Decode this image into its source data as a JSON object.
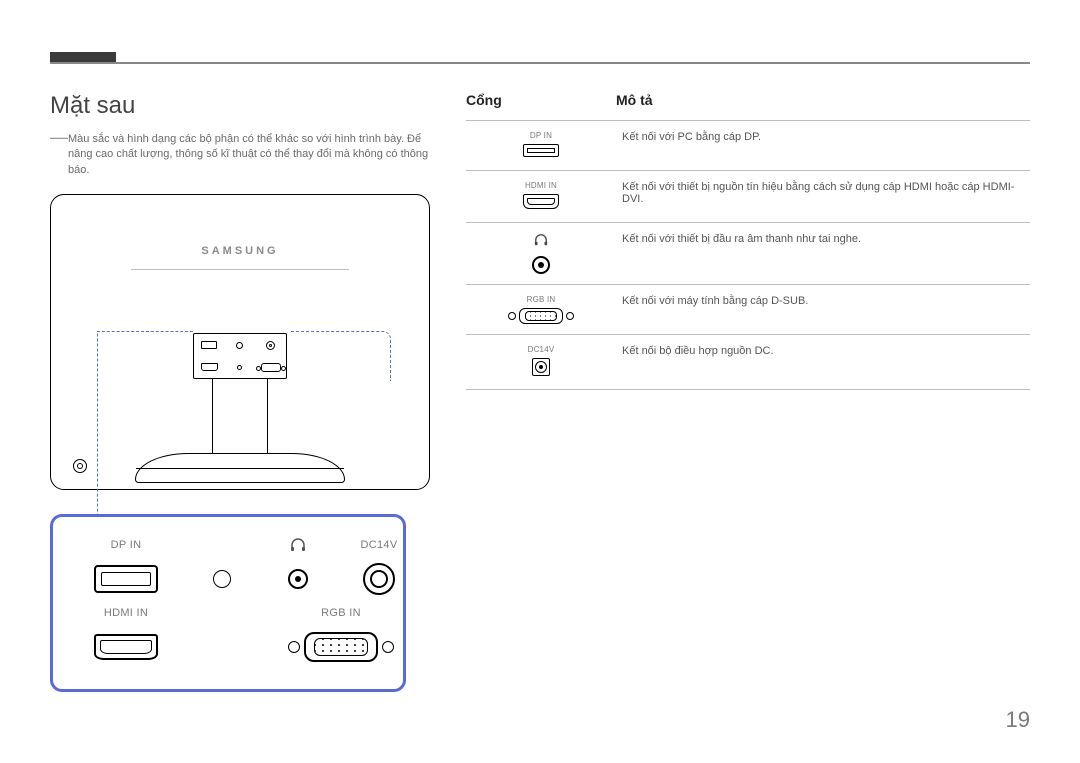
{
  "page": {
    "number": "19"
  },
  "left": {
    "heading": "Mặt sau",
    "note": "Màu sắc và hình dạng các bộ phận có thể khác so với hình trình bày. Để nâng cao chất lượng, thông số kĩ thuật có thể thay đổi mà không có thông báo.",
    "logo": "SAMSUNG",
    "enlarged": {
      "dp": "DP IN",
      "hp_icon": "♫",
      "dc": "DC14V",
      "hdmi": "HDMI IN",
      "rgb": "RGB IN"
    }
  },
  "right": {
    "header_port": "Cổng",
    "header_desc": "Mô tả",
    "rows": [
      {
        "label": "DP IN",
        "desc": "Kết nối với PC bằng cáp DP."
      },
      {
        "label": "HDMI IN",
        "desc": "Kết nối với thiết bị nguồn tín hiệu bằng cách sử dụng cáp HDMI hoặc cáp HDMI-DVI."
      },
      {
        "label": "",
        "desc": "Kết nối với thiết bị đầu ra âm thanh như tai nghe."
      },
      {
        "label": "RGB IN",
        "desc": "Kết nối với máy tính bằng cáp D-SUB."
      },
      {
        "label": "DC14V",
        "desc": "Kết nối bộ điều hợp nguồn DC."
      }
    ]
  }
}
